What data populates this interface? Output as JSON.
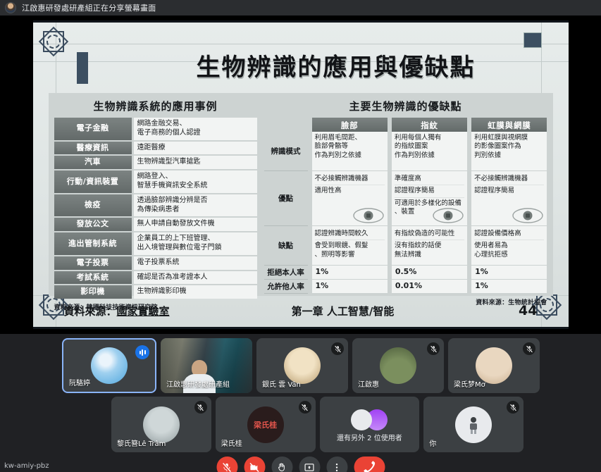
{
  "topbar": {
    "avatar_name": "presenter-avatar",
    "sharing_notice": "江啟惠研發處研產組正在分享螢幕畫面"
  },
  "slide": {
    "title": "生物辨識的應用與優缺點",
    "left_section": {
      "heading": "生物辨識系統的應用事例",
      "rows": [
        {
          "key": "電子金融",
          "value": "網路金融交易、\n電子商務的個人認證"
        },
        {
          "key": "醫療資訊",
          "value": "遠距醫療"
        },
        {
          "key": "汽車",
          "value": "生物辨識型汽車搶匙"
        },
        {
          "key": "行動/資訊裝置",
          "value": "網路登入、\n智慧手機資訊安全系統"
        },
        {
          "key": "檢疫",
          "value": "透過臉部辨識分辨是否\n為傳染病患者"
        },
        {
          "key": "發放公文",
          "value": "無人申請自動發放文件機"
        },
        {
          "key": "進出管制系統",
          "value": "企業員工的上下班管理、\n出入境管理與數位電子門鎖"
        },
        {
          "key": "電子投票",
          "value": "電子投票系統"
        },
        {
          "key": "考試系統",
          "value": "確認是否為准考證本人"
        },
        {
          "key": "影印機",
          "value": "生物辨識影印機"
        }
      ],
      "source": "資料來源：韓國科技技術資訊研究院"
    },
    "right_section": {
      "heading": "主要生物辨識的優缺點",
      "row_labels": [
        "辨識模式",
        "優點",
        "缺點",
        "拒絕本人率",
        "允許他人率"
      ],
      "columns": [
        {
          "header": "臉部",
          "mode": "利用眉毛間距、\n臉部骨骼等\n作為判別之依據",
          "pros": [
            "不必接觸辨識機器",
            "適用性高"
          ],
          "cons": [
            "認證辨識時間較久",
            "會受到眼鏡、假髮\n、照明等影響"
          ],
          "reject_self_rate": "1%",
          "allow_other_rate": "1%"
        },
        {
          "header": "指紋",
          "mode": "利用每個人獨有\n的指紋圖案\n作為判別依據",
          "pros": [
            "準確度高",
            "認證程序簡易",
            "可適用於多樣化的設備\n、裝置"
          ],
          "cons": [
            "有指紋偽造的可能性",
            "沒有指紋的話便\n無法辨識"
          ],
          "reject_self_rate": "0.5%",
          "allow_other_rate": "0.01%"
        },
        {
          "header": "虹膜與網膜",
          "mode": "利用虹膜與視網膜\n的影像圖案作為\n判別依據",
          "pros": [
            "不必接觸辨識機器",
            "認證程序簡易"
          ],
          "cons": [
            "認證設備價格高",
            "使用者易為\n心理抗拒感"
          ],
          "reject_self_rate": "1%",
          "allow_other_rate": "1%"
        }
      ],
      "source": "資料來源：生物統計協會"
    },
    "footer": {
      "source_label": "資料來源：",
      "source_value": "國家實驗室",
      "chapter": "第一章 人工智慧/智能",
      "page": "44"
    }
  },
  "participants": {
    "row1": [
      {
        "name": "阮駱婷",
        "avatar": "sky-avatar",
        "state": "speaking",
        "camera": false
      },
      {
        "name": "江啟惠研發處研產組",
        "avatar": "camera-feed",
        "state": "active",
        "camera": true
      },
      {
        "name": "銀氏 雲 Vân",
        "avatar": "coffee-avatar",
        "state": "muted",
        "camera": false
      },
      {
        "name": "江啟惠",
        "avatar": "green-avatar",
        "state": "muted",
        "camera": false
      },
      {
        "name": "梁氏梦Mơ",
        "avatar": "cat-avatar",
        "state": "muted",
        "camera": false
      }
    ],
    "row2": [
      {
        "name": "黎氏簪Lê Trâm",
        "avatar": "kid-avatar",
        "state": "muted",
        "camera": false
      },
      {
        "name": "梁氏桂",
        "avatar": "initials-avatar",
        "avatar_text": "梁氏桂",
        "state": "muted",
        "camera": false
      },
      {
        "name": "還有另外 2 位使用者",
        "avatar": "group-avatar",
        "state": "overflow",
        "camera": false
      },
      {
        "name": "你",
        "avatar": "person-avatar",
        "state": "muted",
        "camera": false
      }
    ]
  },
  "bottombar": {
    "meeting_code": "kw-amiy-pbz",
    "controls": [
      {
        "name": "mic-off-button",
        "label": "麥克風",
        "style": "danger"
      },
      {
        "name": "camera-off-button",
        "label": "攝影機",
        "style": "danger"
      },
      {
        "name": "raise-hand-button",
        "label": "舉手",
        "style": "neutral"
      },
      {
        "name": "present-button",
        "label": "簡報",
        "style": "neutral"
      },
      {
        "name": "more-options-button",
        "label": "更多選項",
        "style": "neutral"
      },
      {
        "name": "leave-call-button",
        "label": "離開會議",
        "style": "leave"
      }
    ]
  },
  "colors": {
    "accent": "#8ab4f8",
    "danger": "#ea4335",
    "surface": "#3c4043",
    "background": "#202124"
  }
}
